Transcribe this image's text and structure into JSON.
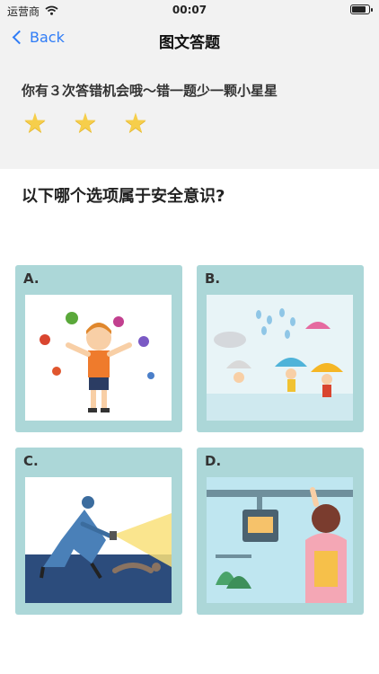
{
  "status": {
    "carrier": "运营商",
    "time": "00:07",
    "battery_level": 0.9
  },
  "nav": {
    "back_label": "Back",
    "title": "图文答题"
  },
  "info": {
    "hint": "你有３次答错机会哦～错一题少一颗小星星",
    "stars": [
      "★",
      "★",
      "★"
    ]
  },
  "question": "以下哪个选项属于安全意识?",
  "options": [
    {
      "label": "A."
    },
    {
      "label": "B."
    },
    {
      "label": "C."
    },
    {
      "label": "D."
    }
  ],
  "colors": {
    "accent": "#2f7cf6",
    "star": "#f6ce4b",
    "card": "#acd7d8",
    "panel": "#f2f2f2"
  }
}
